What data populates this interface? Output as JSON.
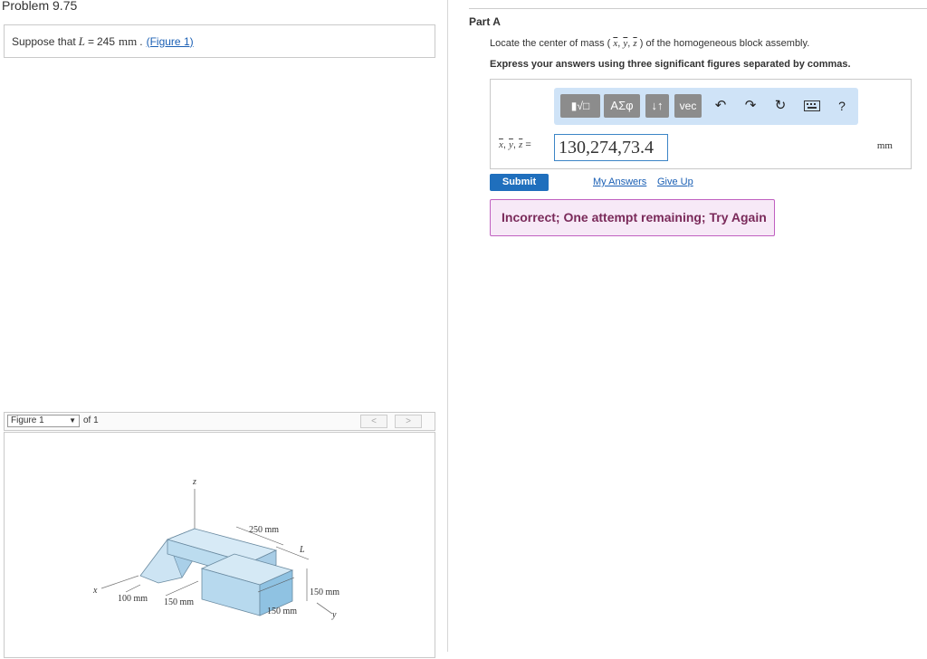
{
  "problem": {
    "title": "Problem 9.75",
    "statement_prefix": "Suppose that",
    "variable": "L",
    "equals": "=",
    "value": "245",
    "unit": "mm",
    "period": ".",
    "figure_link": "(Figure 1)"
  },
  "figure_nav": {
    "selected": "Figure 1",
    "of_text": "of 1",
    "prev": "<",
    "next": ">"
  },
  "figure": {
    "axis_z": "z",
    "axis_x": "x",
    "axis_y": "y",
    "dim_250": "250 mm",
    "dim_L": "L",
    "dim_150_right": "150 mm",
    "dim_150_bottom": "150 mm",
    "dim_150_left": "150 mm",
    "dim_100": "100 mm"
  },
  "part": {
    "label": "Part A",
    "question_prefix": "Locate the center of mass (",
    "question_vars": [
      "x",
      "y",
      "z"
    ],
    "question_suffix": ") of the homogeneous block assembly.",
    "instruction": "Express your answers using three significant figures separated by commas."
  },
  "toolbar": {
    "template_label": "▮√□",
    "greek_label": "ΑΣφ",
    "arrows_label": "↓↑",
    "vec_label": "vec",
    "undo_icon": "undo-icon",
    "redo_icon": "redo-icon",
    "reset_icon": "reset-icon",
    "keyboard_icon": "keyboard-icon",
    "help_label": "?"
  },
  "answer": {
    "label_vars": [
      "x",
      "y",
      "z"
    ],
    "label_equals": "=",
    "value": "130,274,73.4",
    "unit": "mm"
  },
  "actions": {
    "submit": "Submit",
    "my_answers": "My Answers",
    "give_up": "Give Up"
  },
  "feedback": {
    "text": "Incorrect; One attempt remaining; Try Again",
    "border_color": "#c060c0",
    "background_color": "#f7e9f7"
  }
}
